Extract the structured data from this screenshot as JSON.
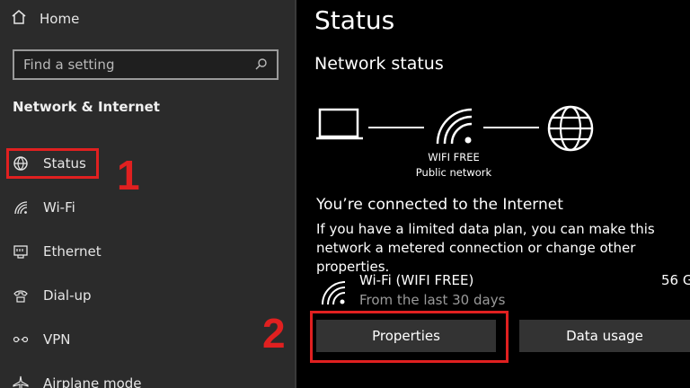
{
  "sidebar": {
    "home_label": "Home",
    "search": {
      "placeholder": "Find a setting"
    },
    "section_title": "Network & Internet",
    "items": [
      {
        "label": "Status",
        "icon": "status-globe-icon"
      },
      {
        "label": "Wi-Fi",
        "icon": "wifi-icon"
      },
      {
        "label": "Ethernet",
        "icon": "ethernet-icon"
      },
      {
        "label": "Dial-up",
        "icon": "dial-up-icon"
      },
      {
        "label": "VPN",
        "icon": "vpn-icon"
      },
      {
        "label": "Airplane mode",
        "icon": "airplane-icon"
      }
    ]
  },
  "annotations": {
    "step1": "1",
    "step2": "2",
    "color": "#e02020"
  },
  "main": {
    "title": "Status",
    "network_status_title": "Network status",
    "network_name": "WIFI FREE",
    "network_type": "Public network",
    "connected_title": "You’re connected to the Internet",
    "description": "If you have a limited data plan, you can make this network a metered connection or change other properties.",
    "connection": {
      "name": "Wi-Fi (WIFI FREE)",
      "subtitle": "From the last 30 days",
      "usage": "56 G"
    },
    "buttons": {
      "properties": "Properties",
      "data_usage": "Data usage"
    }
  }
}
